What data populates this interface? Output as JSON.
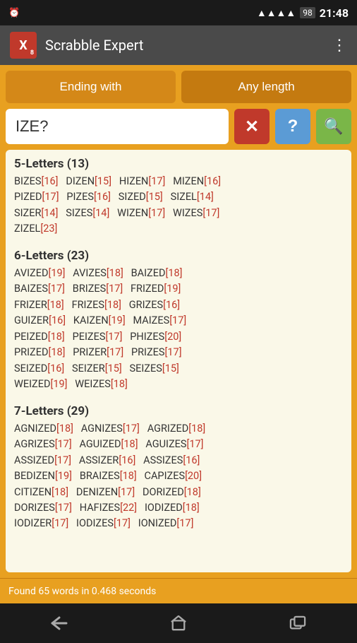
{
  "statusBar": {
    "time": "21:48",
    "battery": "98",
    "alarm": "⏰",
    "signal": "📶"
  },
  "titleBar": {
    "appName": "Scrabble Expert",
    "logoLetter": "X",
    "logoSub": "8",
    "menuIcon": "⋮"
  },
  "filters": {
    "mode": "Ending with",
    "length": "Any length"
  },
  "search": {
    "value": "IZE?",
    "placeholder": "",
    "clearBtn": "✕",
    "helpBtn": "?",
    "searchBtn": "🔍"
  },
  "results": {
    "groups": [
      {
        "header": "5-Letters (13)",
        "words": [
          {
            "text": "BIZES",
            "score": "[16]"
          },
          {
            "text": "DIZEN",
            "score": "[15]"
          },
          {
            "text": "HIZEN",
            "score": "[17]"
          },
          {
            "text": "MIZEN",
            "score": "[16]"
          },
          {
            "text": "PIZED",
            "score": "[17]"
          },
          {
            "text": "PIZES",
            "score": "[16]"
          },
          {
            "text": "SIZED",
            "score": "[15]"
          },
          {
            "text": "SIZEL",
            "score": "[14]"
          },
          {
            "text": "SIZER",
            "score": "[14]"
          },
          {
            "text": "SIZES",
            "score": "[14]"
          },
          {
            "text": "WIZEN",
            "score": "[17]"
          },
          {
            "text": "WIZES",
            "score": "[17]"
          },
          {
            "text": "ZIZEL",
            "score": "[23]"
          }
        ]
      },
      {
        "header": "6-Letters (23)",
        "words": [
          {
            "text": "AVIZED",
            "score": "[19]"
          },
          {
            "text": "AVIZES",
            "score": "[18]"
          },
          {
            "text": "BAIZED",
            "score": "[18]"
          },
          {
            "text": "BAIZES",
            "score": "[17]"
          },
          {
            "text": "BRIZES",
            "score": "[17]"
          },
          {
            "text": "FRIZED",
            "score": "[19]"
          },
          {
            "text": "FRIZER",
            "score": "[18]"
          },
          {
            "text": "FRIZES",
            "score": "[18]"
          },
          {
            "text": "GRIZES",
            "score": "[16]"
          },
          {
            "text": "GUIZER",
            "score": "[16]"
          },
          {
            "text": "KAIZEN",
            "score": "[19]"
          },
          {
            "text": "MAIZES",
            "score": "[17]"
          },
          {
            "text": "PEIZED",
            "score": "[18]"
          },
          {
            "text": "PEIZES",
            "score": "[17]"
          },
          {
            "text": "PHIZES",
            "score": "[20]"
          },
          {
            "text": "PRIZED",
            "score": "[18]"
          },
          {
            "text": "PRIZER",
            "score": "[17]"
          },
          {
            "text": "PRIZES",
            "score": "[17]"
          },
          {
            "text": "SEIZED",
            "score": "[16]"
          },
          {
            "text": "SEIZER",
            "score": "[15]"
          },
          {
            "text": "SEIZES",
            "score": "[15]"
          },
          {
            "text": "WEIZED",
            "score": "[19]"
          },
          {
            "text": "WEIZES",
            "score": "[18]"
          }
        ]
      },
      {
        "header": "7-Letters (29)",
        "words": [
          {
            "text": "AGNIZED",
            "score": "[18]"
          },
          {
            "text": "AGNIZES",
            "score": "[17]"
          },
          {
            "text": "AGRIZED",
            "score": "[18]"
          },
          {
            "text": "AGRIZES",
            "score": "[17]"
          },
          {
            "text": "AGUIZED",
            "score": "[18]"
          },
          {
            "text": "AGUIZES",
            "score": "[17]"
          },
          {
            "text": "ASSIZED",
            "score": "[17]"
          },
          {
            "text": "ASSIZER",
            "score": "[16]"
          },
          {
            "text": "ASSIZES",
            "score": "[16]"
          },
          {
            "text": "BEDIZEN",
            "score": "[19]"
          },
          {
            "text": "BRAIZES",
            "score": "[18]"
          },
          {
            "text": "CAPIZES",
            "score": "[20]"
          },
          {
            "text": "CITIZEN",
            "score": "[18]"
          },
          {
            "text": "DENIZEN",
            "score": "[17]"
          },
          {
            "text": "DORIZED",
            "score": "[18]"
          },
          {
            "text": "DORIZES",
            "score": "[17]"
          },
          {
            "text": "HAFIZES",
            "score": "[22]"
          },
          {
            "text": "IODIZED",
            "score": "[18]"
          },
          {
            "text": "IODIZER",
            "score": "[17]"
          },
          {
            "text": "IODIZES",
            "score": "[17]"
          },
          {
            "text": "IONIZED",
            "score": "[17]"
          }
        ]
      }
    ],
    "statusText": "Found 65 words in 0.468 seconds"
  }
}
